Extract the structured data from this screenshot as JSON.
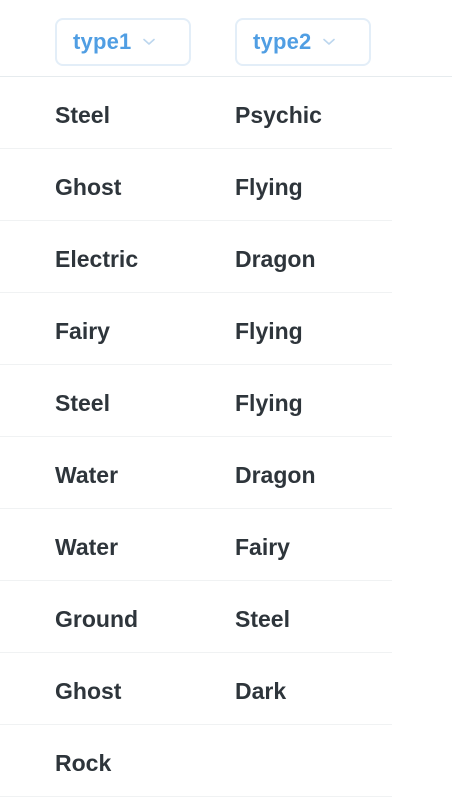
{
  "columns": [
    {
      "label": "type1",
      "icon": "chevron-down-icon"
    },
    {
      "label": "type2",
      "icon": "chevron-down-icon"
    }
  ],
  "rows": [
    {
      "type1": "Steel",
      "type2": "Psychic"
    },
    {
      "type1": "Ghost",
      "type2": "Flying"
    },
    {
      "type1": "Electric",
      "type2": "Dragon"
    },
    {
      "type1": "Fairy",
      "type2": "Flying"
    },
    {
      "type1": "Steel",
      "type2": "Flying"
    },
    {
      "type1": "Water",
      "type2": "Dragon"
    },
    {
      "type1": "Water",
      "type2": "Fairy"
    },
    {
      "type1": "Ground",
      "type2": "Steel"
    },
    {
      "type1": "Ghost",
      "type2": "Dark"
    },
    {
      "type1": "Rock",
      "type2": ""
    }
  ],
  "colors": {
    "accent": "#509ee3",
    "text": "#2e353b",
    "filter_border": "#e3eef8"
  }
}
